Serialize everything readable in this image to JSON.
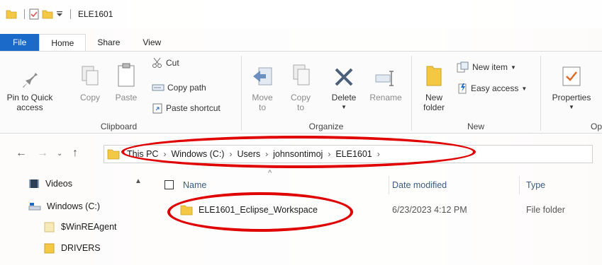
{
  "titlebar": {
    "title": "ELE1601",
    "icons": [
      "folder-icon",
      "properties-check-icon",
      "new-folder-icon",
      "customize-dropdown-icon"
    ]
  },
  "tabs": [
    {
      "label": "File"
    },
    {
      "label": "Home"
    },
    {
      "label": "Share"
    },
    {
      "label": "View"
    }
  ],
  "ribbon": {
    "clipboard": {
      "label": "Clipboard",
      "pin_label_1": "Pin to Quick",
      "pin_label_2": "access",
      "copy": "Copy",
      "paste": "Paste",
      "cut": "Cut",
      "copy_path": "Copy path",
      "paste_shortcut": "Paste shortcut"
    },
    "organize": {
      "label": "Organize",
      "move_to_1": "Move",
      "move_to_2": "to",
      "copy_to_1": "Copy",
      "copy_to_2": "to",
      "delete": "Delete",
      "rename": "Rename"
    },
    "new": {
      "label": "New",
      "new_folder_1": "New",
      "new_folder_2": "folder",
      "new_item": "New item",
      "easy_access": "Easy access"
    },
    "open": {
      "label": "Op",
      "properties": "Properties"
    }
  },
  "address": {
    "crumbs": [
      "This PC",
      "Windows (C:)",
      "Users",
      "johnsontimoj",
      "ELE1601"
    ]
  },
  "navpane": {
    "items": [
      {
        "label": "Videos"
      },
      {
        "label": "Windows (C:)"
      },
      {
        "label": "$WinREAgent"
      },
      {
        "label": "DRIVERS"
      }
    ]
  },
  "filelist": {
    "columns": {
      "name": "Name",
      "date": "Date modified",
      "type": "Type"
    },
    "rows": [
      {
        "name": "ELE1601_Eclipse_Workspace",
        "date": "6/23/2023 4:12 PM",
        "type": "File folder"
      }
    ]
  },
  "colors": {
    "accent": "#1b6ac9",
    "highlight": "#e00000",
    "folder": "#f4c842"
  }
}
